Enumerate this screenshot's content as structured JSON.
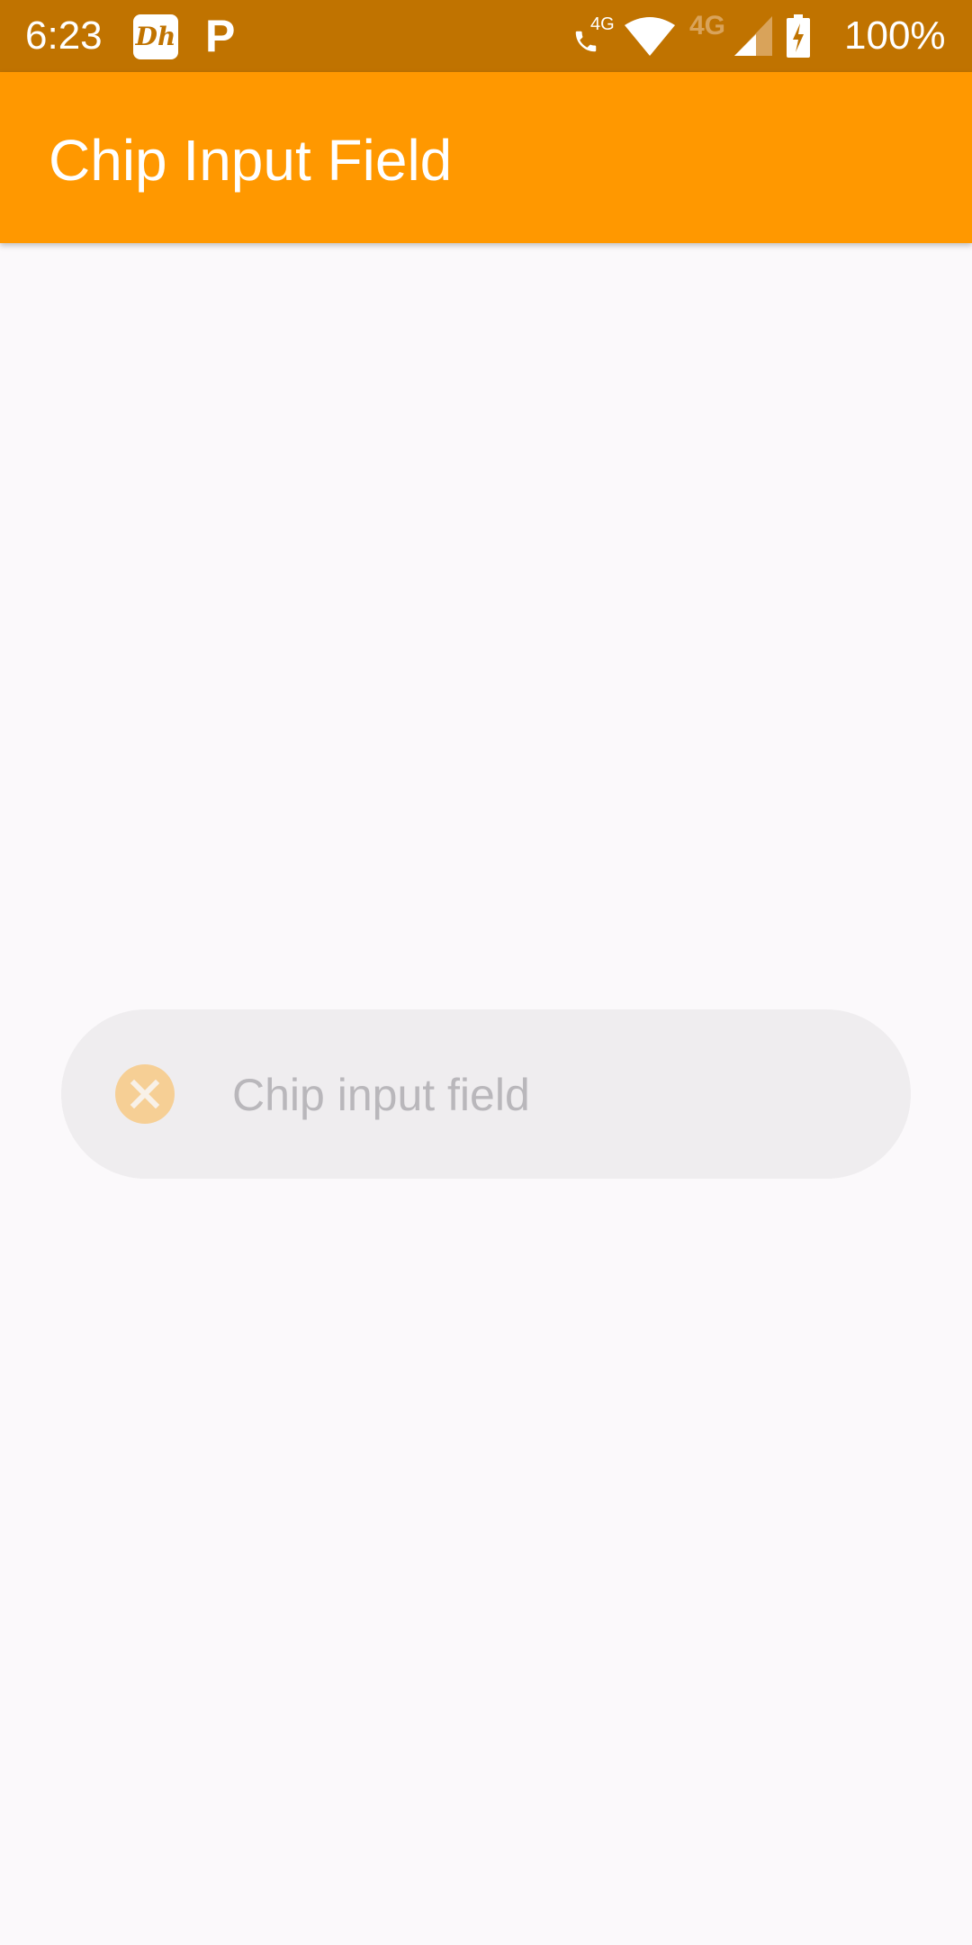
{
  "status_bar": {
    "time": "6:23",
    "notification_icons": [
      "disney-hotstar-icon",
      "p-app-icon"
    ],
    "dh_label": "Dh",
    "p_label": "P",
    "call_network_label": "4G",
    "mobile_network_label": "4G",
    "battery_percent": "100%",
    "background_color": "#c07300"
  },
  "app_bar": {
    "title": "Chip Input Field",
    "color": "#ff9800"
  },
  "chip_field": {
    "value": "",
    "placeholder": "Chip input field",
    "clear_icon": "close-circle-icon",
    "clear_icon_color": "#f6cf95"
  }
}
